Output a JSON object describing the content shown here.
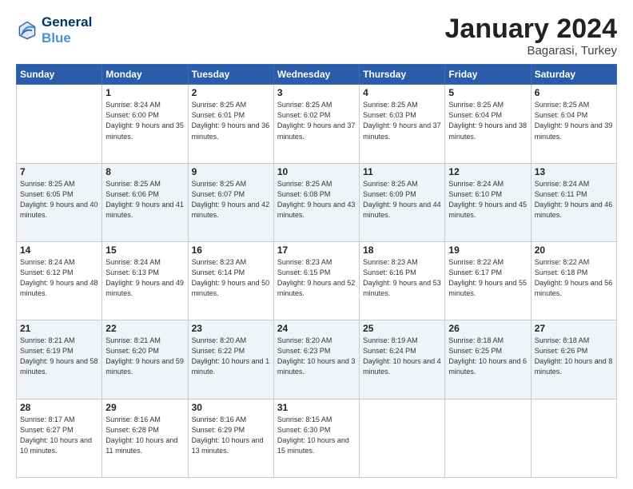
{
  "logo": {
    "line1": "General",
    "line2": "Blue"
  },
  "title": "January 2024",
  "subtitle": "Bagarasi, Turkey",
  "weekdays": [
    "Sunday",
    "Monday",
    "Tuesday",
    "Wednesday",
    "Thursday",
    "Friday",
    "Saturday"
  ],
  "weeks": [
    [
      {
        "day": "",
        "sunrise": "",
        "sunset": "",
        "daylight": ""
      },
      {
        "day": "1",
        "sunrise": "Sunrise: 8:24 AM",
        "sunset": "Sunset: 6:00 PM",
        "daylight": "Daylight: 9 hours and 35 minutes."
      },
      {
        "day": "2",
        "sunrise": "Sunrise: 8:25 AM",
        "sunset": "Sunset: 6:01 PM",
        "daylight": "Daylight: 9 hours and 36 minutes."
      },
      {
        "day": "3",
        "sunrise": "Sunrise: 8:25 AM",
        "sunset": "Sunset: 6:02 PM",
        "daylight": "Daylight: 9 hours and 37 minutes."
      },
      {
        "day": "4",
        "sunrise": "Sunrise: 8:25 AM",
        "sunset": "Sunset: 6:03 PM",
        "daylight": "Daylight: 9 hours and 37 minutes."
      },
      {
        "day": "5",
        "sunrise": "Sunrise: 8:25 AM",
        "sunset": "Sunset: 6:04 PM",
        "daylight": "Daylight: 9 hours and 38 minutes."
      },
      {
        "day": "6",
        "sunrise": "Sunrise: 8:25 AM",
        "sunset": "Sunset: 6:04 PM",
        "daylight": "Daylight: 9 hours and 39 minutes."
      }
    ],
    [
      {
        "day": "7",
        "sunrise": "Sunrise: 8:25 AM",
        "sunset": "Sunset: 6:05 PM",
        "daylight": "Daylight: 9 hours and 40 minutes."
      },
      {
        "day": "8",
        "sunrise": "Sunrise: 8:25 AM",
        "sunset": "Sunset: 6:06 PM",
        "daylight": "Daylight: 9 hours and 41 minutes."
      },
      {
        "day": "9",
        "sunrise": "Sunrise: 8:25 AM",
        "sunset": "Sunset: 6:07 PM",
        "daylight": "Daylight: 9 hours and 42 minutes."
      },
      {
        "day": "10",
        "sunrise": "Sunrise: 8:25 AM",
        "sunset": "Sunset: 6:08 PM",
        "daylight": "Daylight: 9 hours and 43 minutes."
      },
      {
        "day": "11",
        "sunrise": "Sunrise: 8:25 AM",
        "sunset": "Sunset: 6:09 PM",
        "daylight": "Daylight: 9 hours and 44 minutes."
      },
      {
        "day": "12",
        "sunrise": "Sunrise: 8:24 AM",
        "sunset": "Sunset: 6:10 PM",
        "daylight": "Daylight: 9 hours and 45 minutes."
      },
      {
        "day": "13",
        "sunrise": "Sunrise: 8:24 AM",
        "sunset": "Sunset: 6:11 PM",
        "daylight": "Daylight: 9 hours and 46 minutes."
      }
    ],
    [
      {
        "day": "14",
        "sunrise": "Sunrise: 8:24 AM",
        "sunset": "Sunset: 6:12 PM",
        "daylight": "Daylight: 9 hours and 48 minutes."
      },
      {
        "day": "15",
        "sunrise": "Sunrise: 8:24 AM",
        "sunset": "Sunset: 6:13 PM",
        "daylight": "Daylight: 9 hours and 49 minutes."
      },
      {
        "day": "16",
        "sunrise": "Sunrise: 8:23 AM",
        "sunset": "Sunset: 6:14 PM",
        "daylight": "Daylight: 9 hours and 50 minutes."
      },
      {
        "day": "17",
        "sunrise": "Sunrise: 8:23 AM",
        "sunset": "Sunset: 6:15 PM",
        "daylight": "Daylight: 9 hours and 52 minutes."
      },
      {
        "day": "18",
        "sunrise": "Sunrise: 8:23 AM",
        "sunset": "Sunset: 6:16 PM",
        "daylight": "Daylight: 9 hours and 53 minutes."
      },
      {
        "day": "19",
        "sunrise": "Sunrise: 8:22 AM",
        "sunset": "Sunset: 6:17 PM",
        "daylight": "Daylight: 9 hours and 55 minutes."
      },
      {
        "day": "20",
        "sunrise": "Sunrise: 8:22 AM",
        "sunset": "Sunset: 6:18 PM",
        "daylight": "Daylight: 9 hours and 56 minutes."
      }
    ],
    [
      {
        "day": "21",
        "sunrise": "Sunrise: 8:21 AM",
        "sunset": "Sunset: 6:19 PM",
        "daylight": "Daylight: 9 hours and 58 minutes."
      },
      {
        "day": "22",
        "sunrise": "Sunrise: 8:21 AM",
        "sunset": "Sunset: 6:20 PM",
        "daylight": "Daylight: 9 hours and 59 minutes."
      },
      {
        "day": "23",
        "sunrise": "Sunrise: 8:20 AM",
        "sunset": "Sunset: 6:22 PM",
        "daylight": "Daylight: 10 hours and 1 minute."
      },
      {
        "day": "24",
        "sunrise": "Sunrise: 8:20 AM",
        "sunset": "Sunset: 6:23 PM",
        "daylight": "Daylight: 10 hours and 3 minutes."
      },
      {
        "day": "25",
        "sunrise": "Sunrise: 8:19 AM",
        "sunset": "Sunset: 6:24 PM",
        "daylight": "Daylight: 10 hours and 4 minutes."
      },
      {
        "day": "26",
        "sunrise": "Sunrise: 8:18 AM",
        "sunset": "Sunset: 6:25 PM",
        "daylight": "Daylight: 10 hours and 6 minutes."
      },
      {
        "day": "27",
        "sunrise": "Sunrise: 8:18 AM",
        "sunset": "Sunset: 6:26 PM",
        "daylight": "Daylight: 10 hours and 8 minutes."
      }
    ],
    [
      {
        "day": "28",
        "sunrise": "Sunrise: 8:17 AM",
        "sunset": "Sunset: 6:27 PM",
        "daylight": "Daylight: 10 hours and 10 minutes."
      },
      {
        "day": "29",
        "sunrise": "Sunrise: 8:16 AM",
        "sunset": "Sunset: 6:28 PM",
        "daylight": "Daylight: 10 hours and 11 minutes."
      },
      {
        "day": "30",
        "sunrise": "Sunrise: 8:16 AM",
        "sunset": "Sunset: 6:29 PM",
        "daylight": "Daylight: 10 hours and 13 minutes."
      },
      {
        "day": "31",
        "sunrise": "Sunrise: 8:15 AM",
        "sunset": "Sunset: 6:30 PM",
        "daylight": "Daylight: 10 hours and 15 minutes."
      },
      {
        "day": "",
        "sunrise": "",
        "sunset": "",
        "daylight": ""
      },
      {
        "day": "",
        "sunrise": "",
        "sunset": "",
        "daylight": ""
      },
      {
        "day": "",
        "sunrise": "",
        "sunset": "",
        "daylight": ""
      }
    ]
  ]
}
